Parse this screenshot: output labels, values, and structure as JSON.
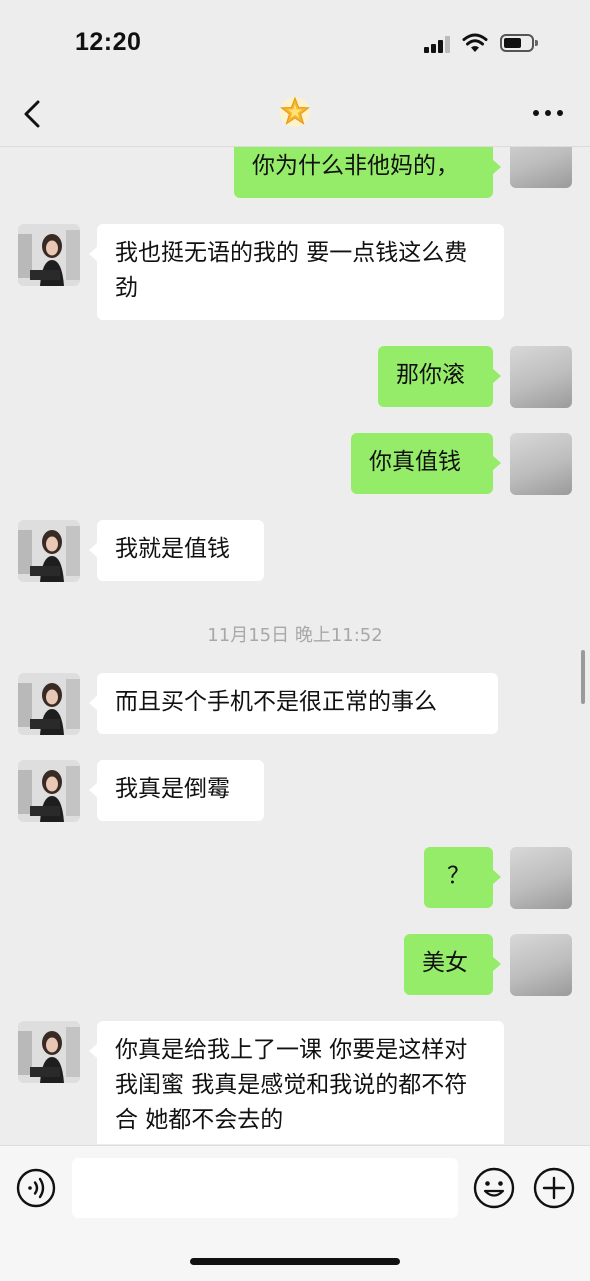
{
  "status_bar": {
    "time": "12:20"
  },
  "nav": {
    "title_icon": "star-emoji-icon"
  },
  "messages": [
    {
      "from": "me",
      "text": "你为什么非他妈的，"
    },
    {
      "from": "her",
      "text": "我也挺无语的我的 要一点钱这么费劲"
    },
    {
      "from": "me",
      "text": "那你滚"
    },
    {
      "from": "me",
      "text": "你真值钱"
    },
    {
      "from": "her",
      "text": "我就是值钱"
    },
    {
      "from": "her",
      "text": "而且买个手机不是很正常的事么"
    },
    {
      "from": "her",
      "text": "我真是倒霉"
    },
    {
      "from": "me",
      "text": "？"
    },
    {
      "from": "me",
      "text": "美女"
    },
    {
      "from": "her",
      "text": "你真是给我上了一课 你要是这样对我闺蜜 我真是感觉和我说的都不符合 她都不会去的"
    }
  ],
  "timestamp": "11月15日 晚上11:52",
  "input": {
    "value": "",
    "placeholder": ""
  },
  "colors": {
    "my_bubble": "#95ec69",
    "her_bubble": "#ffffff",
    "background": "#ededed"
  }
}
